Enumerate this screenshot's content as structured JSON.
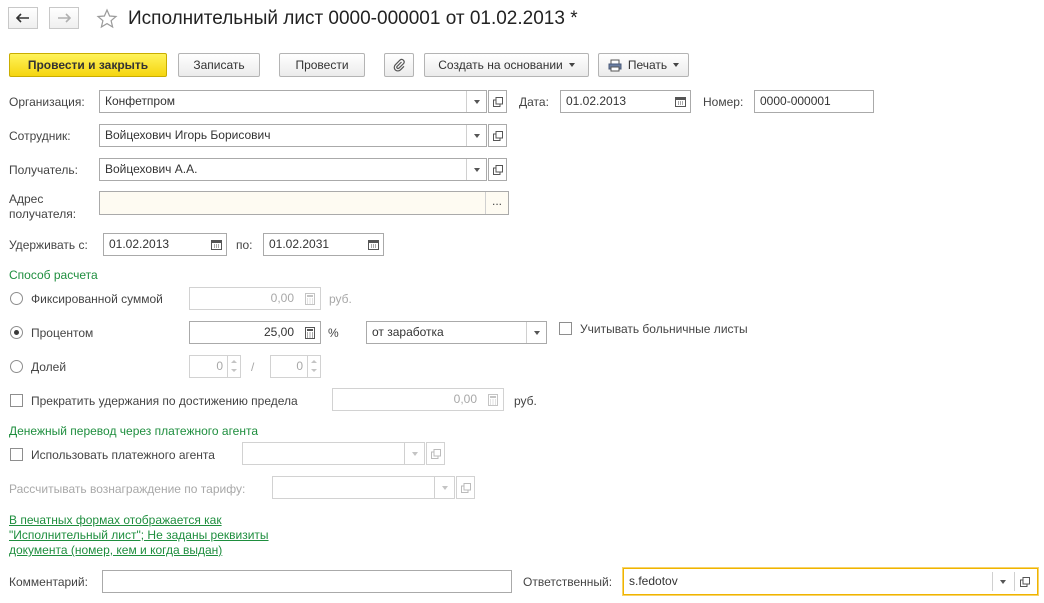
{
  "header": {
    "title": "Исполнительный лист 0000-000001 от 01.02.2013 *"
  },
  "toolbar": {
    "post_close": "Провести и закрыть",
    "save": "Записать",
    "post": "Провести",
    "create_based": "Создать на основании",
    "print": "Печать"
  },
  "form": {
    "org_label": "Организация:",
    "org_value": "Конфетпром",
    "date_label": "Дата:",
    "date_value": "01.02.2013",
    "number_label": "Номер:",
    "number_value": "0000-000001",
    "employee_label": "Сотрудник:",
    "employee_value": "Войцехович Игорь Борисович",
    "recipient_label": "Получатель:",
    "recipient_value": "Войцехович А.А.",
    "address_label_1": "Адрес",
    "address_label_2": "получателя:",
    "address_value": "",
    "address_btn": "...",
    "withhold_from_label": "Удерживать с:",
    "withhold_from_value": "01.02.2013",
    "withhold_to_label": "по:",
    "withhold_to_value": "01.02.2031"
  },
  "calc": {
    "section_title": "Способ расчета",
    "fixed_label": "Фиксированной суммой",
    "fixed_value": "0,00",
    "fixed_unit": "руб.",
    "percent_label": "Процентом",
    "percent_value": "25,00",
    "percent_unit": "%",
    "percent_base": "от заработка",
    "sick_leave_label": "Учитывать больничные листы",
    "share_label": "Долей",
    "share_numerator": "0",
    "share_separator": "/",
    "share_denominator": "0",
    "selected": "percent"
  },
  "limit": {
    "label": "Прекратить удержания по достижению предела",
    "value": "0,00",
    "unit": "руб."
  },
  "transfer": {
    "section_title": "Денежный перевод через платежного агента",
    "use_agent_label": "Использовать платежного агента",
    "use_agent_value": "",
    "tariff_label": "Рассчитывать вознаграждение по тарифу:",
    "tariff_value": ""
  },
  "notice": {
    "line1": "В печатных формах отображается как",
    "line2": "\"Исполнительный лист\"; Не заданы реквизиты",
    "line3": "документа (номер, кем и когда выдан)"
  },
  "footer": {
    "comment_label": "Комментарий:",
    "comment_value": "",
    "responsible_label": "Ответственный:",
    "responsible_value": "s.fedotov"
  },
  "colors": {
    "accent_yellow": "#f5d510",
    "section_green": "#1e8e3e",
    "focus_border": "#f0b400"
  },
  "icons": {
    "back": "arrow-left-icon",
    "forward": "arrow-right-icon",
    "favorite": "star-icon",
    "attach": "paperclip-icon",
    "print": "printer-icon",
    "calendar": "calendar-icon",
    "calculator": "calculator-icon",
    "open": "open-form-icon",
    "dropdown": "chevron-down-icon"
  }
}
